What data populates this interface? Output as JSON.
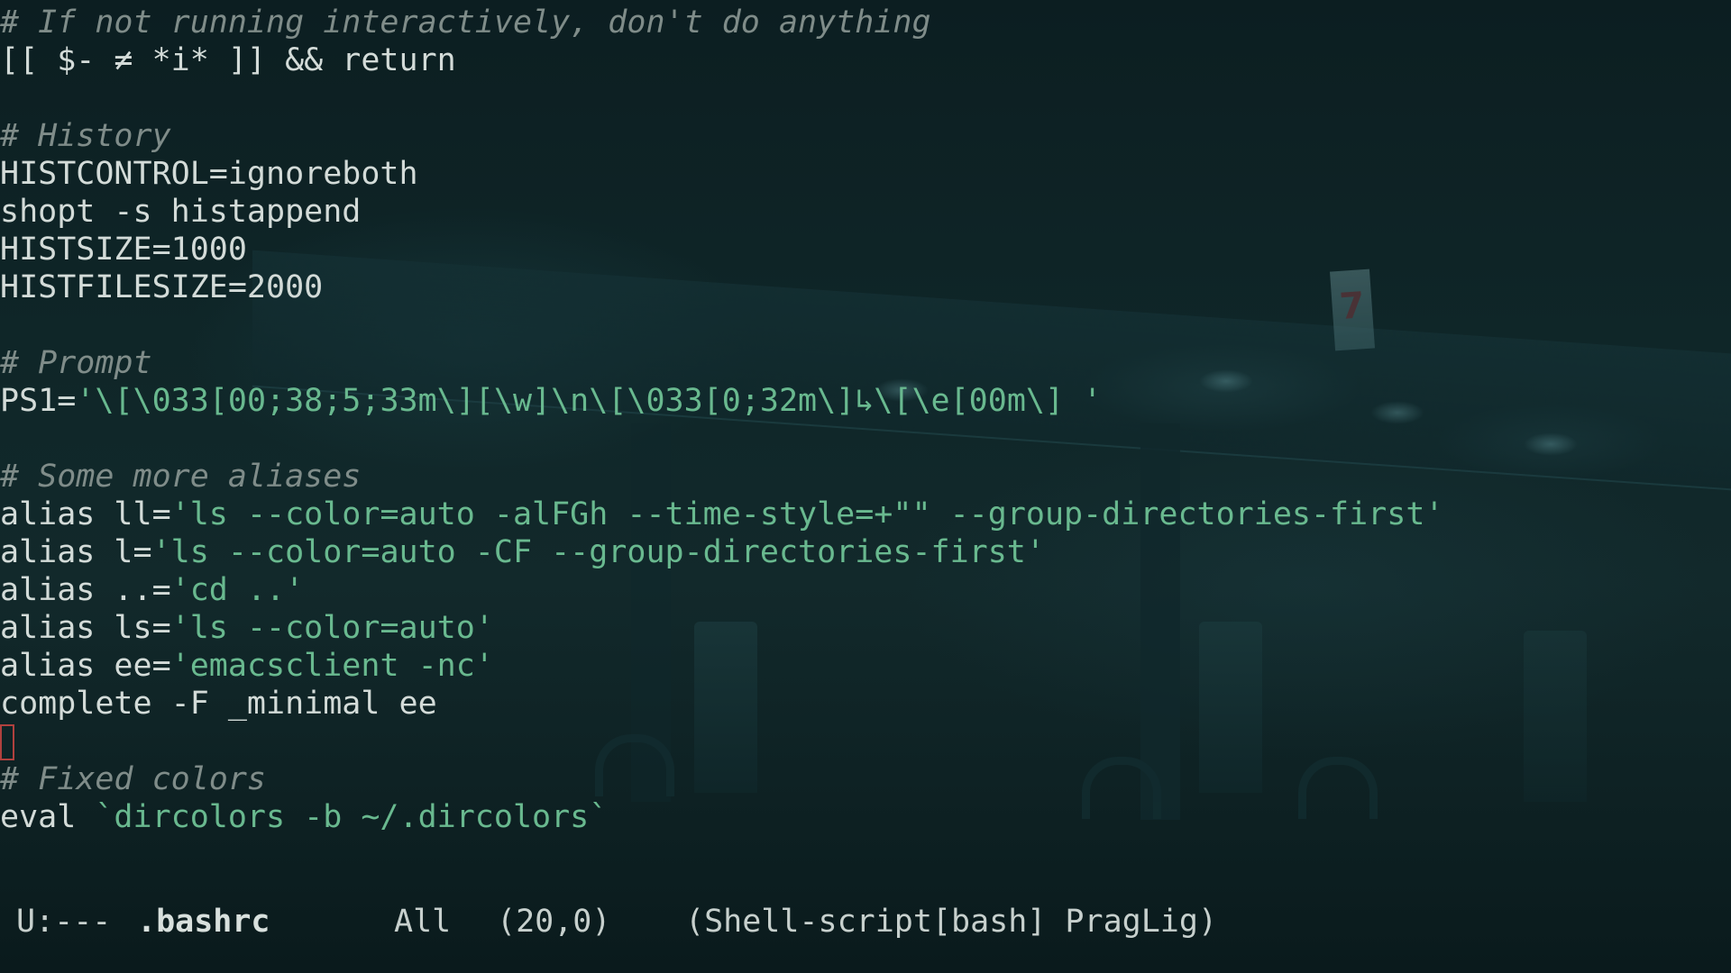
{
  "editor": {
    "lines": [
      [
        {
          "t": "# If not running interactively, don't do anything",
          "c": "comment"
        }
      ],
      [
        {
          "t": "[[ $- ≠ *i* ]] && return",
          "c": "plain"
        }
      ],
      [],
      [
        {
          "t": "# History",
          "c": "comment"
        }
      ],
      [
        {
          "t": "HISTCONTROL=ignoreboth",
          "c": "plain"
        }
      ],
      [
        {
          "t": "shopt -s histappend",
          "c": "plain"
        }
      ],
      [
        {
          "t": "HISTSIZE=1000",
          "c": "plain"
        }
      ],
      [
        {
          "t": "HISTFILESIZE=2000",
          "c": "plain"
        }
      ],
      [],
      [
        {
          "t": "# Prompt",
          "c": "comment"
        }
      ],
      [
        {
          "t": "PS1=",
          "c": "plain"
        },
        {
          "t": "'\\[\\033[00;38;5;33m\\][\\w]\\n\\[\\033[0;32m\\]↳\\[\\e[00m\\] '",
          "c": "str"
        }
      ],
      [],
      [
        {
          "t": "# Some more aliases",
          "c": "comment"
        }
      ],
      [
        {
          "t": "alias ll=",
          "c": "plain"
        },
        {
          "t": "'ls --color=auto -alFGh --time-style=+\"\" --group-directories-first'",
          "c": "str"
        }
      ],
      [
        {
          "t": "alias l=",
          "c": "plain"
        },
        {
          "t": "'ls --color=auto -CF --group-directories-first'",
          "c": "str"
        }
      ],
      [
        {
          "t": "alias ..=",
          "c": "plain"
        },
        {
          "t": "'cd ..'",
          "c": "str"
        }
      ],
      [
        {
          "t": "alias ls=",
          "c": "plain"
        },
        {
          "t": "'ls --color=auto'",
          "c": "str"
        }
      ],
      [
        {
          "t": "alias ee=",
          "c": "plain"
        },
        {
          "t": "'emacsclient -nc'",
          "c": "str"
        }
      ],
      [
        {
          "t": "complete -F _minimal ee",
          "c": "plain"
        }
      ],
      [
        {
          "cursor": true
        }
      ],
      [
        {
          "t": "# Fixed colors",
          "c": "comment"
        }
      ],
      [
        {
          "t": "eval ",
          "c": "plain"
        },
        {
          "t": "`dircolors -b ~/.dircolors`",
          "c": "str"
        }
      ]
    ]
  },
  "modeline": {
    "status": "U:---",
    "buffer_name": ".bashrc",
    "position": "All",
    "line_col": "(20,0)",
    "modes": "(Shell-script[bash] PragLig)"
  },
  "colors": {
    "background": "#0f2628",
    "text": "#d3dbd8",
    "comment": "#7f8c89",
    "string": "#69b98f",
    "cursor": "#b0413e"
  }
}
